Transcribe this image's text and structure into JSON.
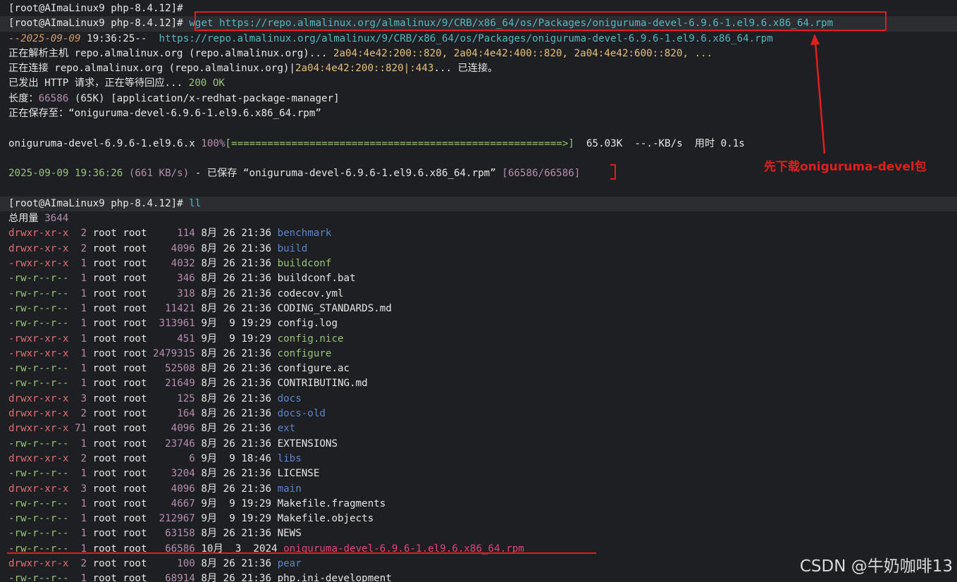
{
  "prompt1": "[root@AImaLinux9 php-8.4.12]# ",
  "prompt2": "[root@AImaLinux9 php-8.4.12]# ",
  "wget_cmd": "wget https://repo.almalinux.org/almalinux/9/CRB/x86_64/os/Packages/oniguruma-devel-6.9.6-1.el9.6.x86_64.rpm",
  "wget_time_date": "--2025-09-09",
  "wget_time": " 19:36:25--",
  "wget_url": "  https://repo.almalinux.org/almalinux/9/CRB/x86_64/os/Packages/oniguruma-devel-6.9.6-1.el9.6.x86_64.rpm",
  "resolve_label": "正在解析主机 repo.almalinux.org (repo.almalinux.org)... ",
  "resolve_ips": "2a04:4e42:200::820, 2a04:4e42:400::820, 2a04:4e42:600::820, ...",
  "connect_label": "正在连接 repo.almalinux.org (repo.almalinux.org)|",
  "connect_ip": "2a04:4e42:200::820|:443",
  "connect_done": "... 已连接。",
  "http_label": "已发出 HTTP 请求，正在等待回应... ",
  "http_status": "200 OK",
  "length_label": "长度：",
  "length_value": "66586",
  "length_rest": " (65K) [application/x-redhat-package-manager]",
  "saving_label": "正在保存至：“oniguruma-devel-6.9.6-1.el9.6.x86_64.rpm”",
  "progress_name": "oniguruma-devel-6.9.6-1.el9.6.x ",
  "progress_pct": "100%",
  "progress_bar": "[=======================================================>]",
  "progress_rest": "  65.03K  --.-KB/s  用时 0.1s",
  "done_time": "2025-09-09 19:36:26 ",
  "done_rate": "(661 KB/s)",
  "done_mid": " - 已保存 “oniguruma-devel-6.9.6-1.el9.6.x86_64.rpm” ",
  "done_count": "[66586/66586]",
  "prompt3": "[root@AImaLinux9 php-8.4.12]# ",
  "ll_cmd": "ll",
  "total_label": "总用量 ",
  "total_value": "3644",
  "annotation": "先下载oniguruma-devel包",
  "watermark": "CSDN @牛奶咖啡13",
  "files": [
    {
      "perm": "drwxr-xr-x",
      "links": " 2",
      "owner": "root",
      "group": "root",
      "size": "    114",
      "month": "8月",
      "day": "26",
      "time": "21:36",
      "name": "benchmark",
      "kind": "dir"
    },
    {
      "perm": "drwxr-xr-x",
      "links": " 2",
      "owner": "root",
      "group": "root",
      "size": "   4096",
      "month": "8月",
      "day": "26",
      "time": "21:36",
      "name": "build",
      "kind": "dir"
    },
    {
      "perm": "-rwxr-xr-x",
      "links": " 1",
      "owner": "root",
      "group": "root",
      "size": "   4032",
      "month": "8月",
      "day": "26",
      "time": "21:36",
      "name": "buildconf",
      "kind": "exe"
    },
    {
      "perm": "-rw-r--r--",
      "links": " 1",
      "owner": "root",
      "group": "root",
      "size": "    346",
      "month": "8月",
      "day": "26",
      "time": "21:36",
      "name": "buildconf.bat",
      "kind": "file"
    },
    {
      "perm": "-rw-r--r--",
      "links": " 1",
      "owner": "root",
      "group": "root",
      "size": "    318",
      "month": "8月",
      "day": "26",
      "time": "21:36",
      "name": "codecov.yml",
      "kind": "file"
    },
    {
      "perm": "-rw-r--r--",
      "links": " 1",
      "owner": "root",
      "group": "root",
      "size": "  11421",
      "month": "8月",
      "day": "26",
      "time": "21:36",
      "name": "CODING_STANDARDS.md",
      "kind": "file"
    },
    {
      "perm": "-rw-r--r--",
      "links": " 1",
      "owner": "root",
      "group": "root",
      "size": " 313961",
      "month": "9月",
      "day": " 9",
      "time": "19:29",
      "name": "config.log",
      "kind": "file"
    },
    {
      "perm": "-rwxr-xr-x",
      "links": " 1",
      "owner": "root",
      "group": "root",
      "size": "    451",
      "month": "9月",
      "day": " 9",
      "time": "19:29",
      "name": "config.nice",
      "kind": "exe"
    },
    {
      "perm": "-rwxr-xr-x",
      "links": " 1",
      "owner": "root",
      "group": "root",
      "size": "2479315",
      "month": "8月",
      "day": "26",
      "time": "21:36",
      "name": "configure",
      "kind": "exe"
    },
    {
      "perm": "-rw-r--r--",
      "links": " 1",
      "owner": "root",
      "group": "root",
      "size": "  52508",
      "month": "8月",
      "day": "26",
      "time": "21:36",
      "name": "configure.ac",
      "kind": "file"
    },
    {
      "perm": "-rw-r--r--",
      "links": " 1",
      "owner": "root",
      "group": "root",
      "size": "  21649",
      "month": "8月",
      "day": "26",
      "time": "21:36",
      "name": "CONTRIBUTING.md",
      "kind": "file"
    },
    {
      "perm": "drwxr-xr-x",
      "links": " 3",
      "owner": "root",
      "group": "root",
      "size": "    125",
      "month": "8月",
      "day": "26",
      "time": "21:36",
      "name": "docs",
      "kind": "dir"
    },
    {
      "perm": "drwxr-xr-x",
      "links": " 2",
      "owner": "root",
      "group": "root",
      "size": "    164",
      "month": "8月",
      "day": "26",
      "time": "21:36",
      "name": "docs-old",
      "kind": "dir"
    },
    {
      "perm": "drwxr-xr-x",
      "links": "71",
      "owner": "root",
      "group": "root",
      "size": "   4096",
      "month": "8月",
      "day": "26",
      "time": "21:36",
      "name": "ext",
      "kind": "dir"
    },
    {
      "perm": "-rw-r--r--",
      "links": " 1",
      "owner": "root",
      "group": "root",
      "size": "  23746",
      "month": "8月",
      "day": "26",
      "time": "21:36",
      "name": "EXTENSIONS",
      "kind": "file"
    },
    {
      "perm": "drwxr-xr-x",
      "links": " 2",
      "owner": "root",
      "group": "root",
      "size": "      6",
      "month": "9月",
      "day": " 9",
      "time": "18:46",
      "name": "libs",
      "kind": "dir"
    },
    {
      "perm": "-rw-r--r--",
      "links": " 1",
      "owner": "root",
      "group": "root",
      "size": "   3204",
      "month": "8月",
      "day": "26",
      "time": "21:36",
      "name": "LICENSE",
      "kind": "file"
    },
    {
      "perm": "drwxr-xr-x",
      "links": " 3",
      "owner": "root",
      "group": "root",
      "size": "   4096",
      "month": "8月",
      "day": "26",
      "time": "21:36",
      "name": "main",
      "kind": "dir"
    },
    {
      "perm": "-rw-r--r--",
      "links": " 1",
      "owner": "root",
      "group": "root",
      "size": "   4667",
      "month": "9月",
      "day": " 9",
      "time": "19:29",
      "name": "Makefile.fragments",
      "kind": "file"
    },
    {
      "perm": "-rw-r--r--",
      "links": " 1",
      "owner": "root",
      "group": "root",
      "size": " 212967",
      "month": "9月",
      "day": " 9",
      "time": "19:29",
      "name": "Makefile.objects",
      "kind": "file"
    },
    {
      "perm": "-rw-r--r--",
      "links": " 1",
      "owner": "root",
      "group": "root",
      "size": "  63158",
      "month": "8月",
      "day": "26",
      "time": "21:36",
      "name": "NEWS",
      "kind": "file"
    },
    {
      "perm": "-rw-r--r--",
      "links": " 1",
      "owner": "root",
      "group": "root",
      "size": "  66586",
      "month": "10月",
      "day": " 3",
      "time": " 2024",
      "name": "oniguruma-devel-6.9.6-1.el9.6.x86_64.rpm",
      "kind": "rpm"
    },
    {
      "perm": "drwxr-xr-x",
      "links": " 2",
      "owner": "root",
      "group": "root",
      "size": "    100",
      "month": "8月",
      "day": "26",
      "time": "21:36",
      "name": "pear",
      "kind": "dir"
    },
    {
      "perm": "-rw-r--r--",
      "links": " 1",
      "owner": "root",
      "group": "root",
      "size": "  68914",
      "month": "8月",
      "day": "26",
      "time": "21:36",
      "name": "php.ini-development",
      "kind": "file"
    }
  ]
}
